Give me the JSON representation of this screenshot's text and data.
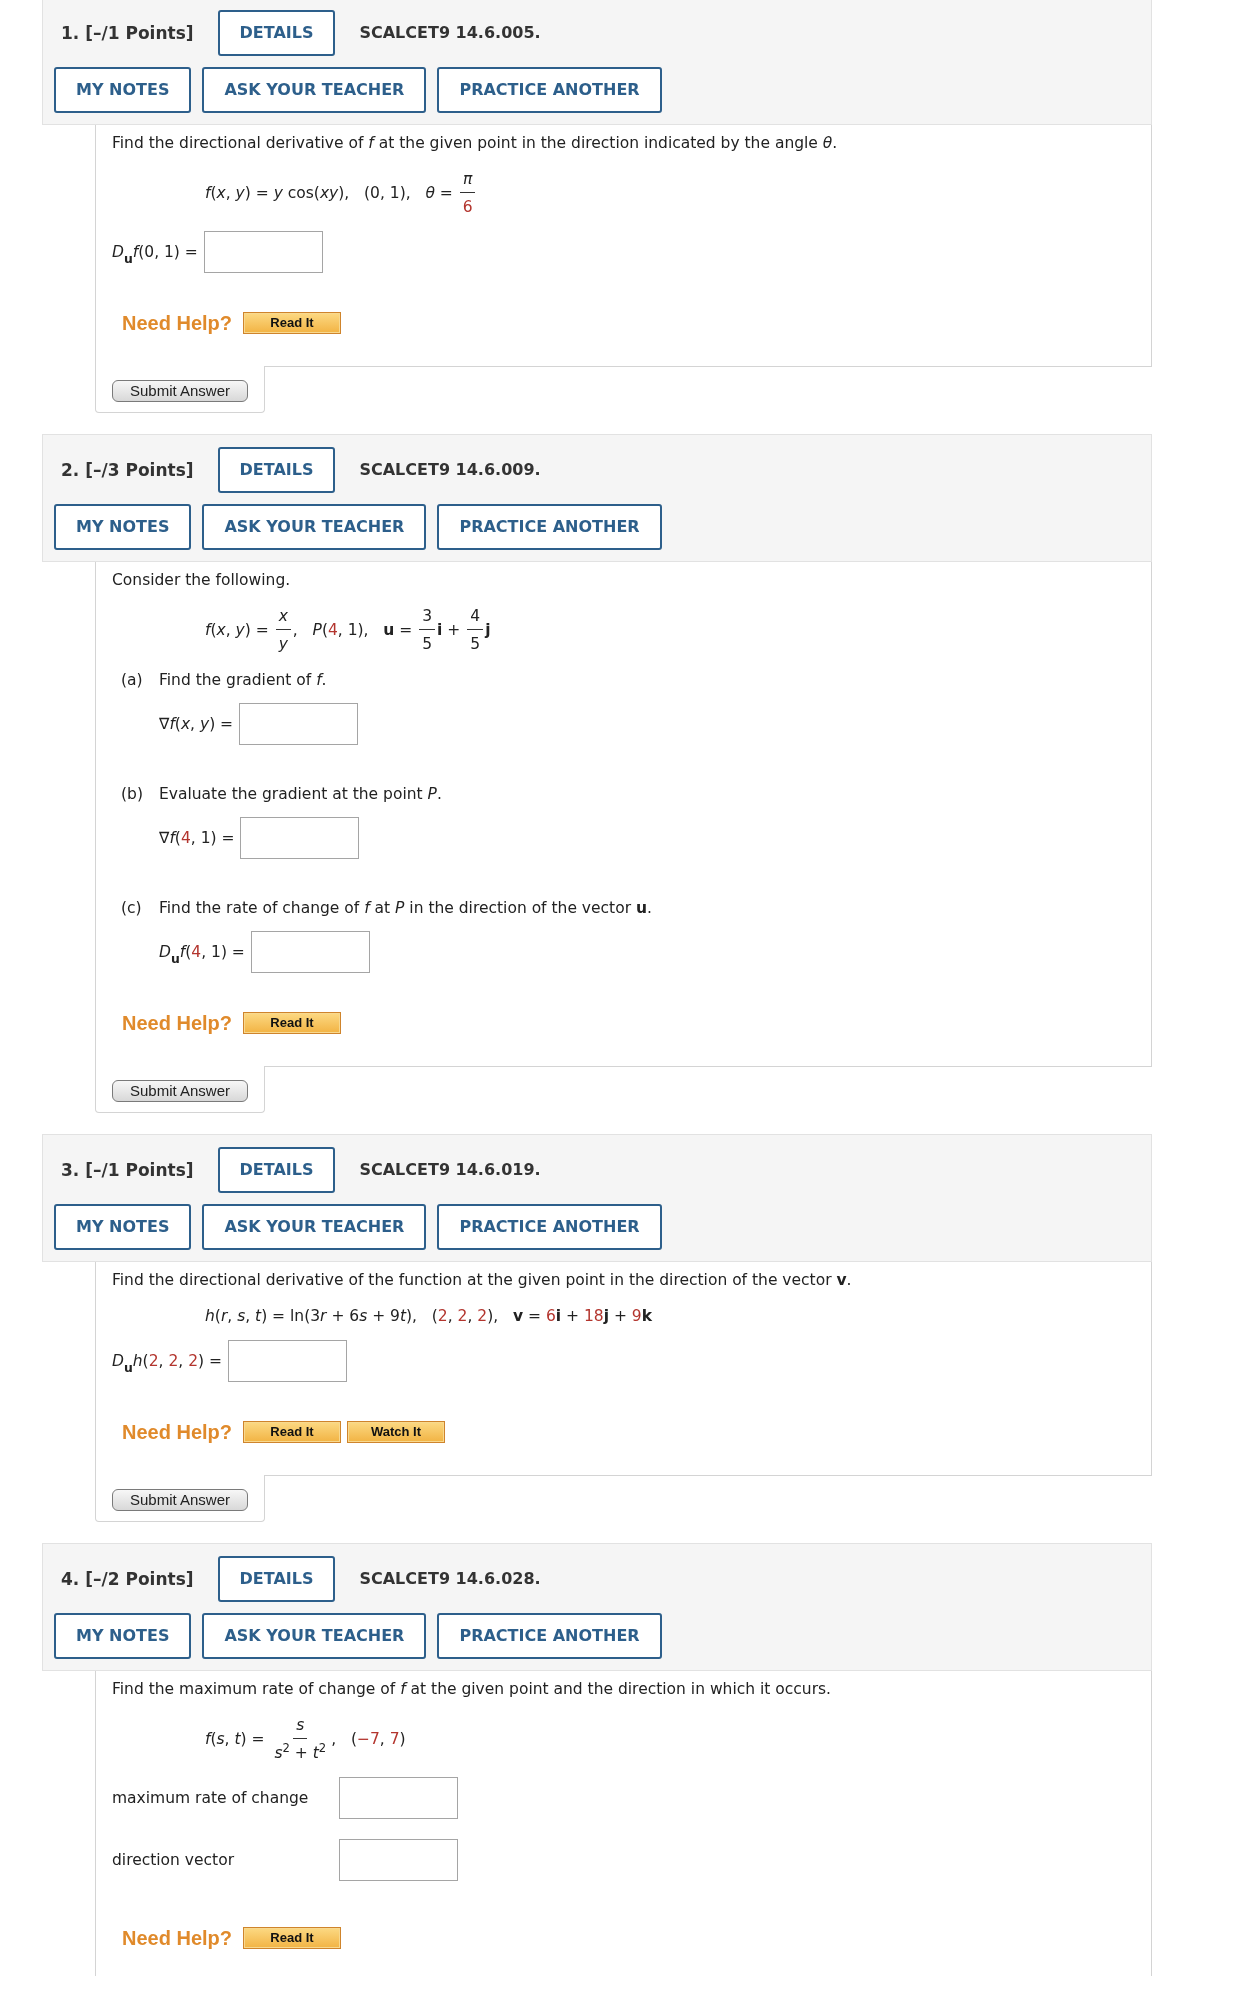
{
  "questions": [
    {
      "heading": "1. [–/1 Points]",
      "details": "DETAILS",
      "code": "SCALCET9 14.6.005.",
      "actions": [
        "MY NOTES",
        "ASK YOUR TEACHER",
        "PRACTICE ANOTHER"
      ],
      "prompt": "Find the directional derivative of *f* at the given point in the direction indicated by the angle *θ*.",
      "formula": [
        {
          "kind": "text",
          "text": "*f*(*x*, *y*) = *y* cos(*xy*),   (0, 1),   *θ* = "
        },
        {
          "kind": "frac",
          "num": [
            {
              "kind": "text",
              "text": "*π*"
            }
          ],
          "den": [
            {
              "kind": "param",
              "text": "6"
            }
          ]
        }
      ],
      "answers": [
        {
          "kind": "math",
          "label": [
            {
              "kind": "text",
              "text": "*D*$_{u}$*f*(0, 1) ="
            }
          ]
        }
      ],
      "help": {
        "label": "Need Help?",
        "buttons": [
          "Read It"
        ]
      },
      "submit": "Submit Answer"
    },
    {
      "heading": "2. [–/3 Points]",
      "details": "DETAILS",
      "code": "SCALCET9 14.6.009.",
      "actions": [
        "MY NOTES",
        "ASK YOUR TEACHER",
        "PRACTICE ANOTHER"
      ],
      "prompt": "Consider the following.",
      "formula": [
        {
          "kind": "text",
          "text": "*f*(*x*, *y*) = "
        },
        {
          "kind": "frac",
          "num": [
            {
              "kind": "text",
              "text": "*x*"
            }
          ],
          "den": [
            {
              "kind": "text",
              "text": "*y*"
            }
          ]
        },
        {
          "kind": "text",
          "text": ",   *P*("
        },
        {
          "kind": "param",
          "text": "4"
        },
        {
          "kind": "text",
          "text": ", 1),   **u** = "
        },
        {
          "kind": "frac",
          "num": [
            {
              "kind": "text",
              "text": "3"
            }
          ],
          "den": [
            {
              "kind": "text",
              "text": "5"
            }
          ]
        },
        {
          "kind": "text",
          "text": "**i** + "
        },
        {
          "kind": "frac",
          "num": [
            {
              "kind": "text",
              "text": "4"
            }
          ],
          "den": [
            {
              "kind": "text",
              "text": "5"
            }
          ]
        },
        {
          "kind": "text",
          "text": "**j**"
        }
      ],
      "parts": [
        {
          "letter": "(a)",
          "prompt": "Find the gradient of *f*.",
          "answers": [
            {
              "kind": "math",
              "label": [
                {
                  "kind": "text",
                  "text": "∇*f*(*x*, *y*) ="
                }
              ]
            }
          ]
        },
        {
          "letter": "(b)",
          "prompt": "Evaluate the gradient at the point *P*.",
          "answers": [
            {
              "kind": "math",
              "label": [
                {
                  "kind": "text",
                  "text": "∇*f*("
                },
                {
                  "kind": "param",
                  "text": "4"
                },
                {
                  "kind": "text",
                  "text": ", 1) ="
                }
              ]
            }
          ]
        },
        {
          "letter": "(c)",
          "prompt": "Find the rate of change of *f* at *P* in the direction of the vector **u**.",
          "answers": [
            {
              "kind": "math",
              "label": [
                {
                  "kind": "text",
                  "text": "*D*$_{u}$*f*("
                },
                {
                  "kind": "param",
                  "text": "4"
                },
                {
                  "kind": "text",
                  "text": ", 1) ="
                }
              ]
            }
          ]
        }
      ],
      "help": {
        "label": "Need Help?",
        "buttons": [
          "Read It"
        ]
      },
      "submit": "Submit Answer"
    },
    {
      "heading": "3. [–/1 Points]",
      "details": "DETAILS",
      "code": "SCALCET9 14.6.019.",
      "actions": [
        "MY NOTES",
        "ASK YOUR TEACHER",
        "PRACTICE ANOTHER"
      ],
      "prompt": "Find the directional derivative of the function at the given point in the direction of the vector **v**.",
      "formula": [
        {
          "kind": "text",
          "text": "*h*(*r*, *s*, *t*) = ln(3"
        },
        {
          "kind": "text",
          "text": "*r* + 6"
        },
        {
          "kind": "text",
          "text": "*s* + 9"
        },
        {
          "kind": "text",
          "text": "*t*),   ("
        },
        {
          "kind": "param",
          "text": "2"
        },
        {
          "kind": "text",
          "text": ", "
        },
        {
          "kind": "param",
          "text": "2"
        },
        {
          "kind": "text",
          "text": ", "
        },
        {
          "kind": "param",
          "text": "2"
        },
        {
          "kind": "text",
          "text": "),   **v** = "
        },
        {
          "kind": "param",
          "text": "6"
        },
        {
          "kind": "text",
          "text": "**i** + "
        },
        {
          "kind": "param",
          "text": "18"
        },
        {
          "kind": "text",
          "text": "**j** + "
        },
        {
          "kind": "param",
          "text": "9"
        },
        {
          "kind": "text",
          "text": "**k**"
        }
      ],
      "answers": [
        {
          "kind": "math",
          "label": [
            {
              "kind": "text",
              "text": "*D*$_{u}$*h*("
            },
            {
              "kind": "param",
              "text": "2"
            },
            {
              "kind": "text",
              "text": ", "
            },
            {
              "kind": "param",
              "text": "2"
            },
            {
              "kind": "text",
              "text": ", "
            },
            {
              "kind": "param",
              "text": "2"
            },
            {
              "kind": "text",
              "text": ") ="
            }
          ]
        }
      ],
      "help": {
        "label": "Need Help?",
        "buttons": [
          "Read It",
          "Watch It"
        ]
      },
      "submit": "Submit Answer"
    },
    {
      "heading": "4. [–/2 Points]",
      "details": "DETAILS",
      "code": "SCALCET9 14.6.028.",
      "actions": [
        "MY NOTES",
        "ASK YOUR TEACHER",
        "PRACTICE ANOTHER"
      ],
      "prompt": "Find the maximum rate of change of *f* at the given point and the direction in which it occurs.",
      "formula": [
        {
          "kind": "text",
          "text": "*f*(*s*, *t*) = "
        },
        {
          "kind": "frac",
          "num": [
            {
              "kind": "text",
              "text": "*s*"
            }
          ],
          "den": [
            {
              "kind": "text",
              "text": "*s*$^{2}$ + *t*$^{2}$"
            }
          ]
        },
        {
          "kind": "text",
          "text": ",   ("
        },
        {
          "kind": "param",
          "text": "−7"
        },
        {
          "kind": "text",
          "text": ", "
        },
        {
          "kind": "param",
          "text": "7"
        },
        {
          "kind": "text",
          "text": ")"
        }
      ],
      "answers": [
        {
          "kind": "text",
          "label": "maximum rate of change"
        },
        {
          "kind": "text",
          "label": "direction vector"
        }
      ],
      "help": {
        "label": "Need Help?",
        "buttons": [
          "Read It"
        ]
      }
    }
  ]
}
